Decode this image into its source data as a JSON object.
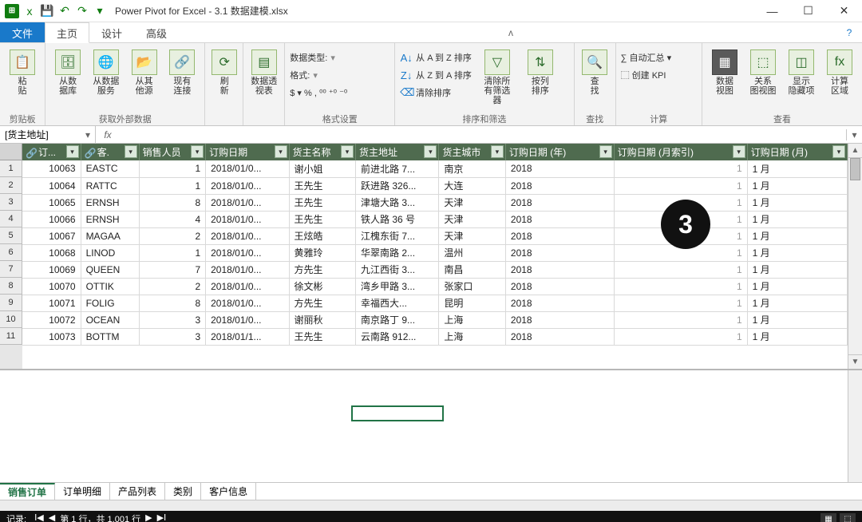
{
  "title": "Power Pivot for Excel - 3.1 数据建模.xlsx",
  "qat": {
    "excel": "x",
    "save": "💾",
    "undo": "↶",
    "redo": "↷"
  },
  "tabs": {
    "file": "文件",
    "home": "主页",
    "design": "设计",
    "advanced": "高级"
  },
  "ribbon": {
    "clipboard": {
      "label": "剪贴板",
      "paste": "粘\n贴"
    },
    "external": {
      "label": "获取外部数据",
      "db": "从数\n据库",
      "svc": "从数据\n服务",
      "other": "从其\n他源",
      "existing": "现有\n连接"
    },
    "refresh": "刷\n新",
    "pivot": "数据透\n视表",
    "format": {
      "label": "格式设置",
      "datatype": "数据类型:",
      "fmt": "格式:",
      "symbols": "$ ▾ % , ⁰⁰ ⁺⁰ ⁻⁰"
    },
    "sort": {
      "label": "排序和筛选",
      "az": "从 A 到 Z 排序",
      "za": "从 Z 到 A 排序",
      "clear": "清除排序",
      "clearfilter": "清除所\n有筛选器",
      "bycol": "按列\n排序"
    },
    "find": {
      "label": "查找",
      "btn": "查\n找"
    },
    "calc": {
      "label": "计算",
      "autosum": "∑ 自动汇总 ▾",
      "kpi": "⬚ 创建 KPI"
    },
    "view": {
      "label": "查看",
      "dataview": "数据\n视图",
      "diagram": "关系\n图视图",
      "hidden": "显示\n隐藏项",
      "calcarea": "计算\n区域"
    }
  },
  "namebox": "[货主地址]",
  "fx_label": "fx",
  "columns": [
    "订...",
    "客.",
    "销售人员",
    "订购日期",
    "货主名称",
    "货主地址",
    "货主城市",
    "订购日期 (年)",
    "订购日期 (月索引)",
    "订购日期 (月)"
  ],
  "rows": [
    {
      "r": "1",
      "c0": "10063",
      "c1": "EASTC",
      "c2": "1",
      "c3": "2018/01/0...",
      "c4": "谢小姐",
      "c5": "前进北路 7...",
      "c6": "南京",
      "c7": "2018",
      "c8": "1",
      "c9": "1 月"
    },
    {
      "r": "2",
      "c0": "10064",
      "c1": "RATTC",
      "c2": "1",
      "c3": "2018/01/0...",
      "c4": "王先生",
      "c5": "跃进路 326...",
      "c6": "大连",
      "c7": "2018",
      "c8": "1",
      "c9": "1 月"
    },
    {
      "r": "3",
      "c0": "10065",
      "c1": "ERNSH",
      "c2": "8",
      "c3": "2018/01/0...",
      "c4": "王先生",
      "c5": "津塘大路 3...",
      "c6": "天津",
      "c7": "2018",
      "c8": "1",
      "c9": "1 月"
    },
    {
      "r": "4",
      "c0": "10066",
      "c1": "ERNSH",
      "c2": "4",
      "c3": "2018/01/0...",
      "c4": "王先生",
      "c5": "铁人路 36 号",
      "c6": "天津",
      "c7": "2018",
      "c8": "1",
      "c9": "1 月"
    },
    {
      "r": "5",
      "c0": "10067",
      "c1": "MAGAA",
      "c2": "2",
      "c3": "2018/01/0...",
      "c4": "王炫皓",
      "c5": "江槐东街 7...",
      "c6": "天津",
      "c7": "2018",
      "c8": "1",
      "c9": "1 月"
    },
    {
      "r": "6",
      "c0": "10068",
      "c1": "LINOD",
      "c2": "1",
      "c3": "2018/01/0...",
      "c4": "黄雅玲",
      "c5": "华翠南路 2...",
      "c6": "温州",
      "c7": "2018",
      "c8": "1",
      "c9": "1 月"
    },
    {
      "r": "7",
      "c0": "10069",
      "c1": "QUEEN",
      "c2": "7",
      "c3": "2018/01/0...",
      "c4": "方先生",
      "c5": "九江西街 3...",
      "c6": "南昌",
      "c7": "2018",
      "c8": "1",
      "c9": "1 月"
    },
    {
      "r": "8",
      "c0": "10070",
      "c1": "OTTIK",
      "c2": "2",
      "c3": "2018/01/0...",
      "c4": "徐文彬",
      "c5": "湾乡甲路 3...",
      "c6": "张家口",
      "c7": "2018",
      "c8": "1",
      "c9": "1 月"
    },
    {
      "r": "9",
      "c0": "10071",
      "c1": "FOLIG",
      "c2": "8",
      "c3": "2018/01/0...",
      "c4": "方先生",
      "c5": "幸福西大...",
      "c6": "昆明",
      "c7": "2018",
      "c8": "1",
      "c9": "1 月"
    },
    {
      "r": "10",
      "c0": "10072",
      "c1": "OCEAN",
      "c2": "3",
      "c3": "2018/01/0...",
      "c4": "谢丽秋",
      "c5": "南京路丁 9...",
      "c6": "上海",
      "c7": "2018",
      "c8": "1",
      "c9": "1 月"
    },
    {
      "r": "11",
      "c0": "10073",
      "c1": "BOTTM",
      "c2": "3",
      "c3": "2018/01/1...",
      "c4": "王先生",
      "c5": "云南路 912...",
      "c6": "上海",
      "c7": "2018",
      "c8": "1",
      "c9": "1 月"
    }
  ],
  "sheets": [
    "销售订单",
    "订单明细",
    "产品列表",
    "类别",
    "客户信息"
  ],
  "status": {
    "record": "记录:",
    "pos": "第 1 行，共 1,001 行"
  },
  "step_marker": "3",
  "glyphs": {
    "minimize": "—",
    "maximize": "☐",
    "close": "✕",
    "qat_dd": "▾",
    "help": "?",
    "caret_up": "ʌ",
    "filter_dd": "▾",
    "link_ico": "🔗",
    "nav_first": "Ⅰ◀",
    "nav_prev": "◀",
    "nav_next": "▶",
    "nav_last": "▶Ⅰ",
    "scroll_up": "▲",
    "scroll_down": "▼"
  }
}
